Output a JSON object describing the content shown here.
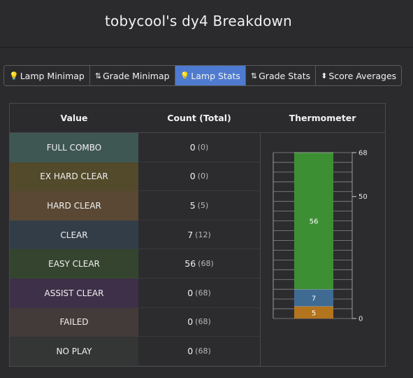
{
  "header": {
    "title": "tobycool's dy4 Breakdown"
  },
  "tabs": [
    {
      "label": "Lamp Minimap",
      "icon": "lightbulb-icon",
      "glyph": "💡",
      "active": false
    },
    {
      "label": "Grade Minimap",
      "icon": "sort-amount-icon",
      "glyph": "⇅",
      "active": false
    },
    {
      "label": "Lamp Stats",
      "icon": "lightbulb-icon",
      "glyph": "💡",
      "active": true
    },
    {
      "label": "Grade Stats",
      "icon": "sort-amount-icon",
      "glyph": "⇅",
      "active": false
    },
    {
      "label": "Score Averages",
      "icon": "sort-icon",
      "glyph": "⬍",
      "active": false
    }
  ],
  "table": {
    "headers": {
      "value": "Value",
      "count": "Count (Total)",
      "thermometer": "Thermometer"
    },
    "rows": [
      {
        "value": "FULL COMBO",
        "count": "0",
        "total": "(0)",
        "color": "#3f5753"
      },
      {
        "value": "EX HARD CLEAR",
        "count": "0",
        "total": "(0)",
        "color": "#524a2b"
      },
      {
        "value": "HARD CLEAR",
        "count": "5",
        "total": "(5)",
        "color": "#5a4834"
      },
      {
        "value": "CLEAR",
        "count": "7",
        "total": "(12)",
        "color": "#333d47"
      },
      {
        "value": "EASY CLEAR",
        "count": "56",
        "total": "(68)",
        "color": "#35442f"
      },
      {
        "value": "ASSIST CLEAR",
        "count": "0",
        "total": "(68)",
        "color": "#3e3048"
      },
      {
        "value": "FAILED",
        "count": "0",
        "total": "(68)",
        "color": "#433a3a"
      },
      {
        "value": "NO PLAY",
        "count": "0",
        "total": "(68)",
        "color": "#343535"
      }
    ]
  },
  "chart_data": {
    "type": "bar",
    "stacked": true,
    "max": 68,
    "segments": [
      {
        "name": "HARD CLEAR",
        "value": 5,
        "color": "#b3741e"
      },
      {
        "name": "CLEAR",
        "value": 7,
        "color": "#3f6a92"
      },
      {
        "name": "EASY CLEAR",
        "value": 56,
        "color": "#3d8f34"
      }
    ],
    "ticks": [
      {
        "value": 0,
        "label": "0"
      },
      {
        "value": 50,
        "label": "50"
      },
      {
        "value": 68,
        "label": "68"
      }
    ],
    "segment_labels": [
      "5",
      "7",
      "56"
    ]
  }
}
